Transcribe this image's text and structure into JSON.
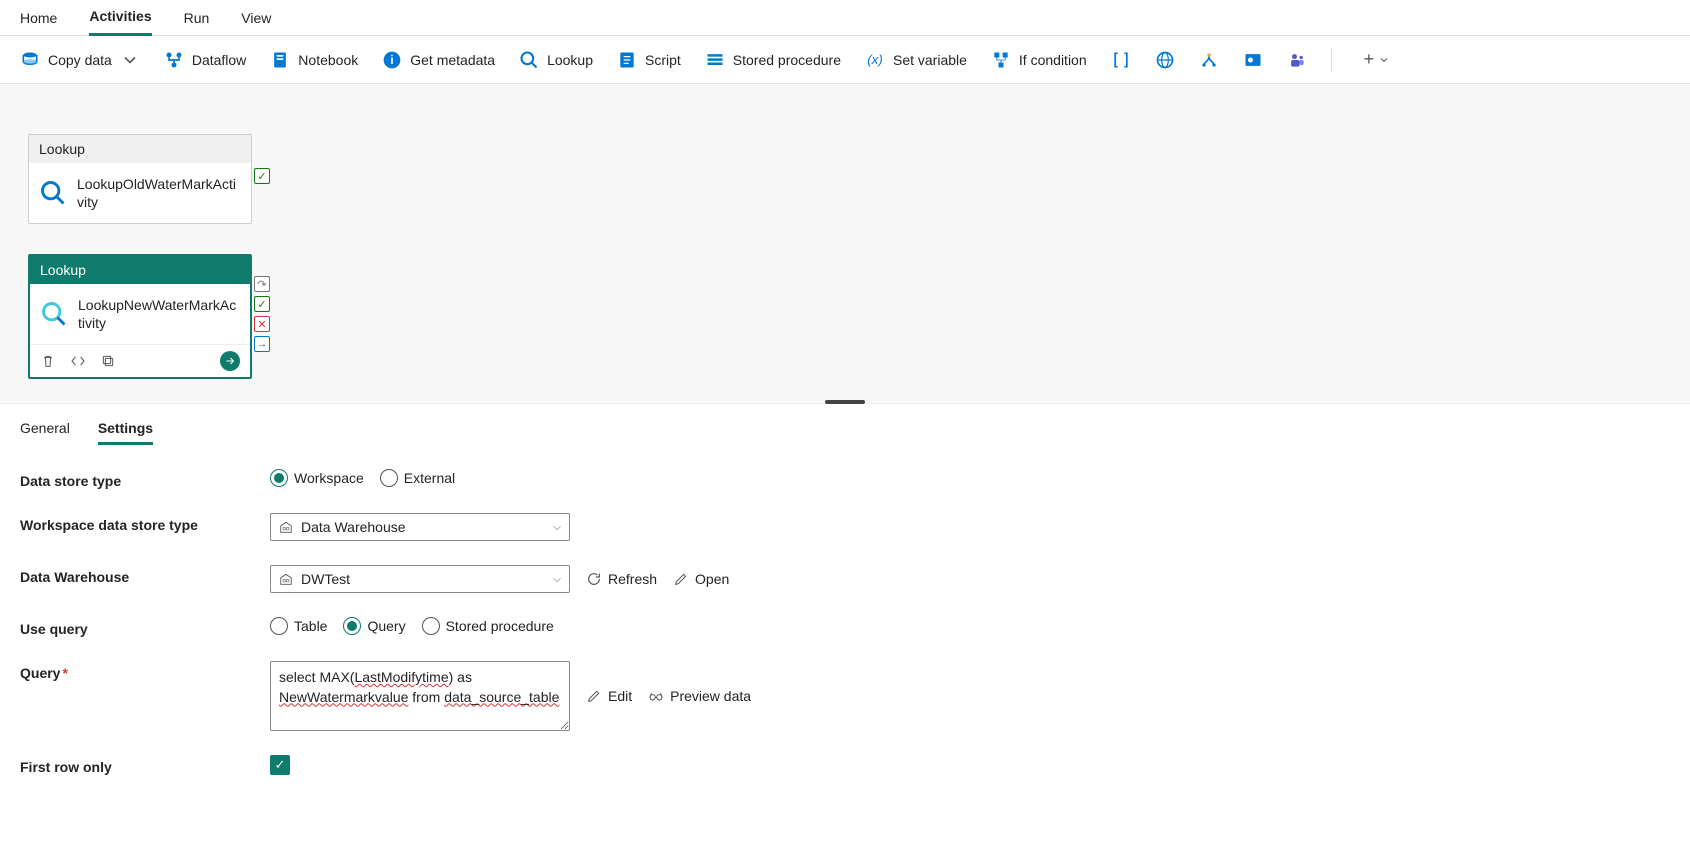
{
  "topTabs": [
    "Home",
    "Activities",
    "Run",
    "View"
  ],
  "activeTopTab": "Activities",
  "toolbar": {
    "copyData": "Copy data",
    "dataflow": "Dataflow",
    "notebook": "Notebook",
    "getMetadata": "Get metadata",
    "lookup": "Lookup",
    "script": "Script",
    "storedProc": "Stored procedure",
    "setVariable": "Set variable",
    "ifCondition": "If condition"
  },
  "canvas": {
    "node1": {
      "type": "Lookup",
      "name": "LookupOldWaterMarkActivity"
    },
    "node2": {
      "type": "Lookup",
      "name": "LookupNewWaterMarkActivity"
    }
  },
  "propTabs": [
    "General",
    "Settings"
  ],
  "activePropTab": "Settings",
  "settings": {
    "dataStoreType": {
      "label": "Data store type",
      "options": [
        "Workspace",
        "External"
      ],
      "value": "Workspace"
    },
    "wsDataStoreType": {
      "label": "Workspace data store type",
      "value": "Data Warehouse"
    },
    "dataWarehouse": {
      "label": "Data Warehouse",
      "value": "DWTest",
      "refresh": "Refresh",
      "open": "Open"
    },
    "useQuery": {
      "label": "Use query",
      "options": [
        "Table",
        "Query",
        "Stored procedure"
      ],
      "value": "Query"
    },
    "query": {
      "label": "Query",
      "value": "select MAX(LastModifytime) as NewWatermarkvalue from data_source_table",
      "edit": "Edit",
      "preview": "Preview data"
    },
    "firstRowOnly": {
      "label": "First row only",
      "checked": true
    }
  }
}
